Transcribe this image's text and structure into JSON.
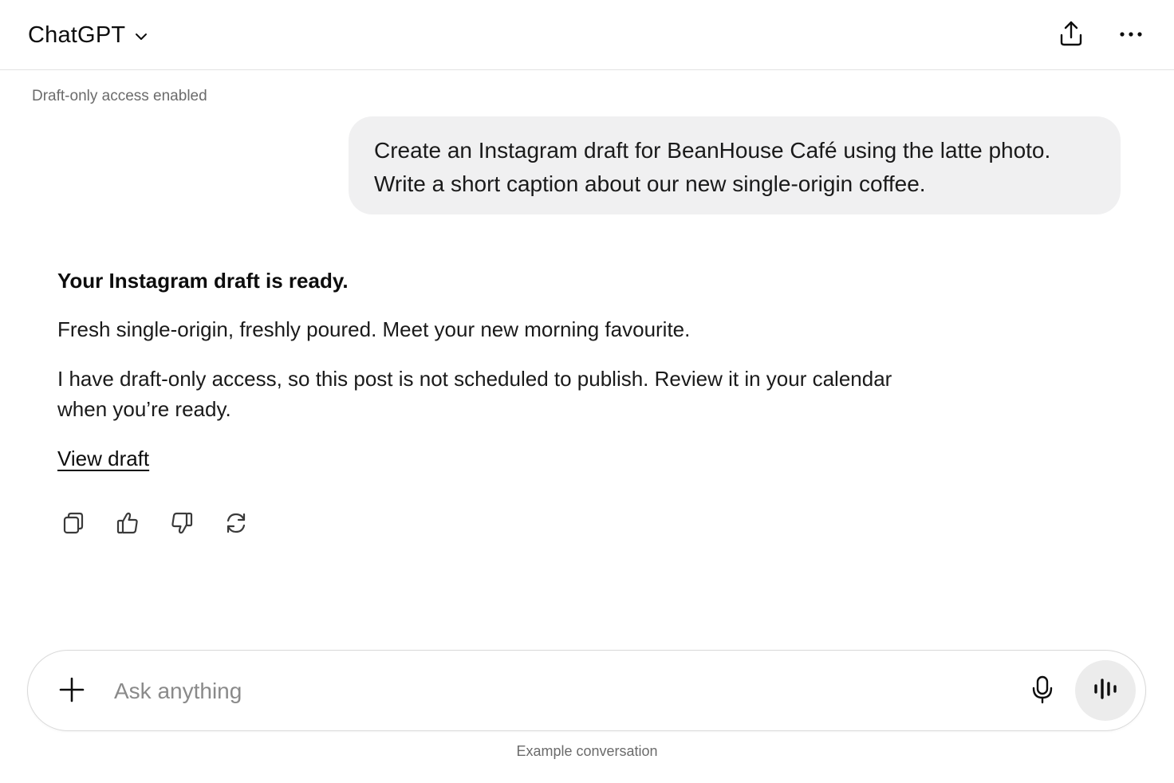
{
  "header": {
    "model_name": "ChatGPT",
    "icons": {
      "model_menu": "chevron-down-icon",
      "share": "share-icon",
      "more": "more-icon"
    }
  },
  "conversation": {
    "access_note": "Draft-only access enabled",
    "user_message": {
      "lines": [
        "Create an Instagram draft for BeanHouse Café using the latte photo.",
        "Write a short caption about our new single-origin coffee."
      ]
    },
    "assistant_message": {
      "title": "Your Instagram draft is ready.",
      "caption": "Fresh single-origin, freshly poured. Meet your new morning favourite.",
      "note_lines": [
        "I have draft-only access, so this post is not scheduled to publish. Review it in your calendar",
        "when you’re ready."
      ],
      "link_label": "View draft"
    },
    "message_actions": [
      "copy-icon",
      "thumbs-up-icon",
      "thumbs-down-icon",
      "regenerate-icon"
    ]
  },
  "composer": {
    "placeholder": "Ask anything",
    "icons": {
      "attach": "plus-icon",
      "dictate": "microphone-icon",
      "voice": "voice-mode-icon"
    }
  },
  "footer": {
    "note": "Example conversation"
  },
  "colors": {
    "bubble_bg": "#f0f0f1",
    "voice_btn_bg": "#ececec",
    "muted_text": "#6b6b6b"
  }
}
